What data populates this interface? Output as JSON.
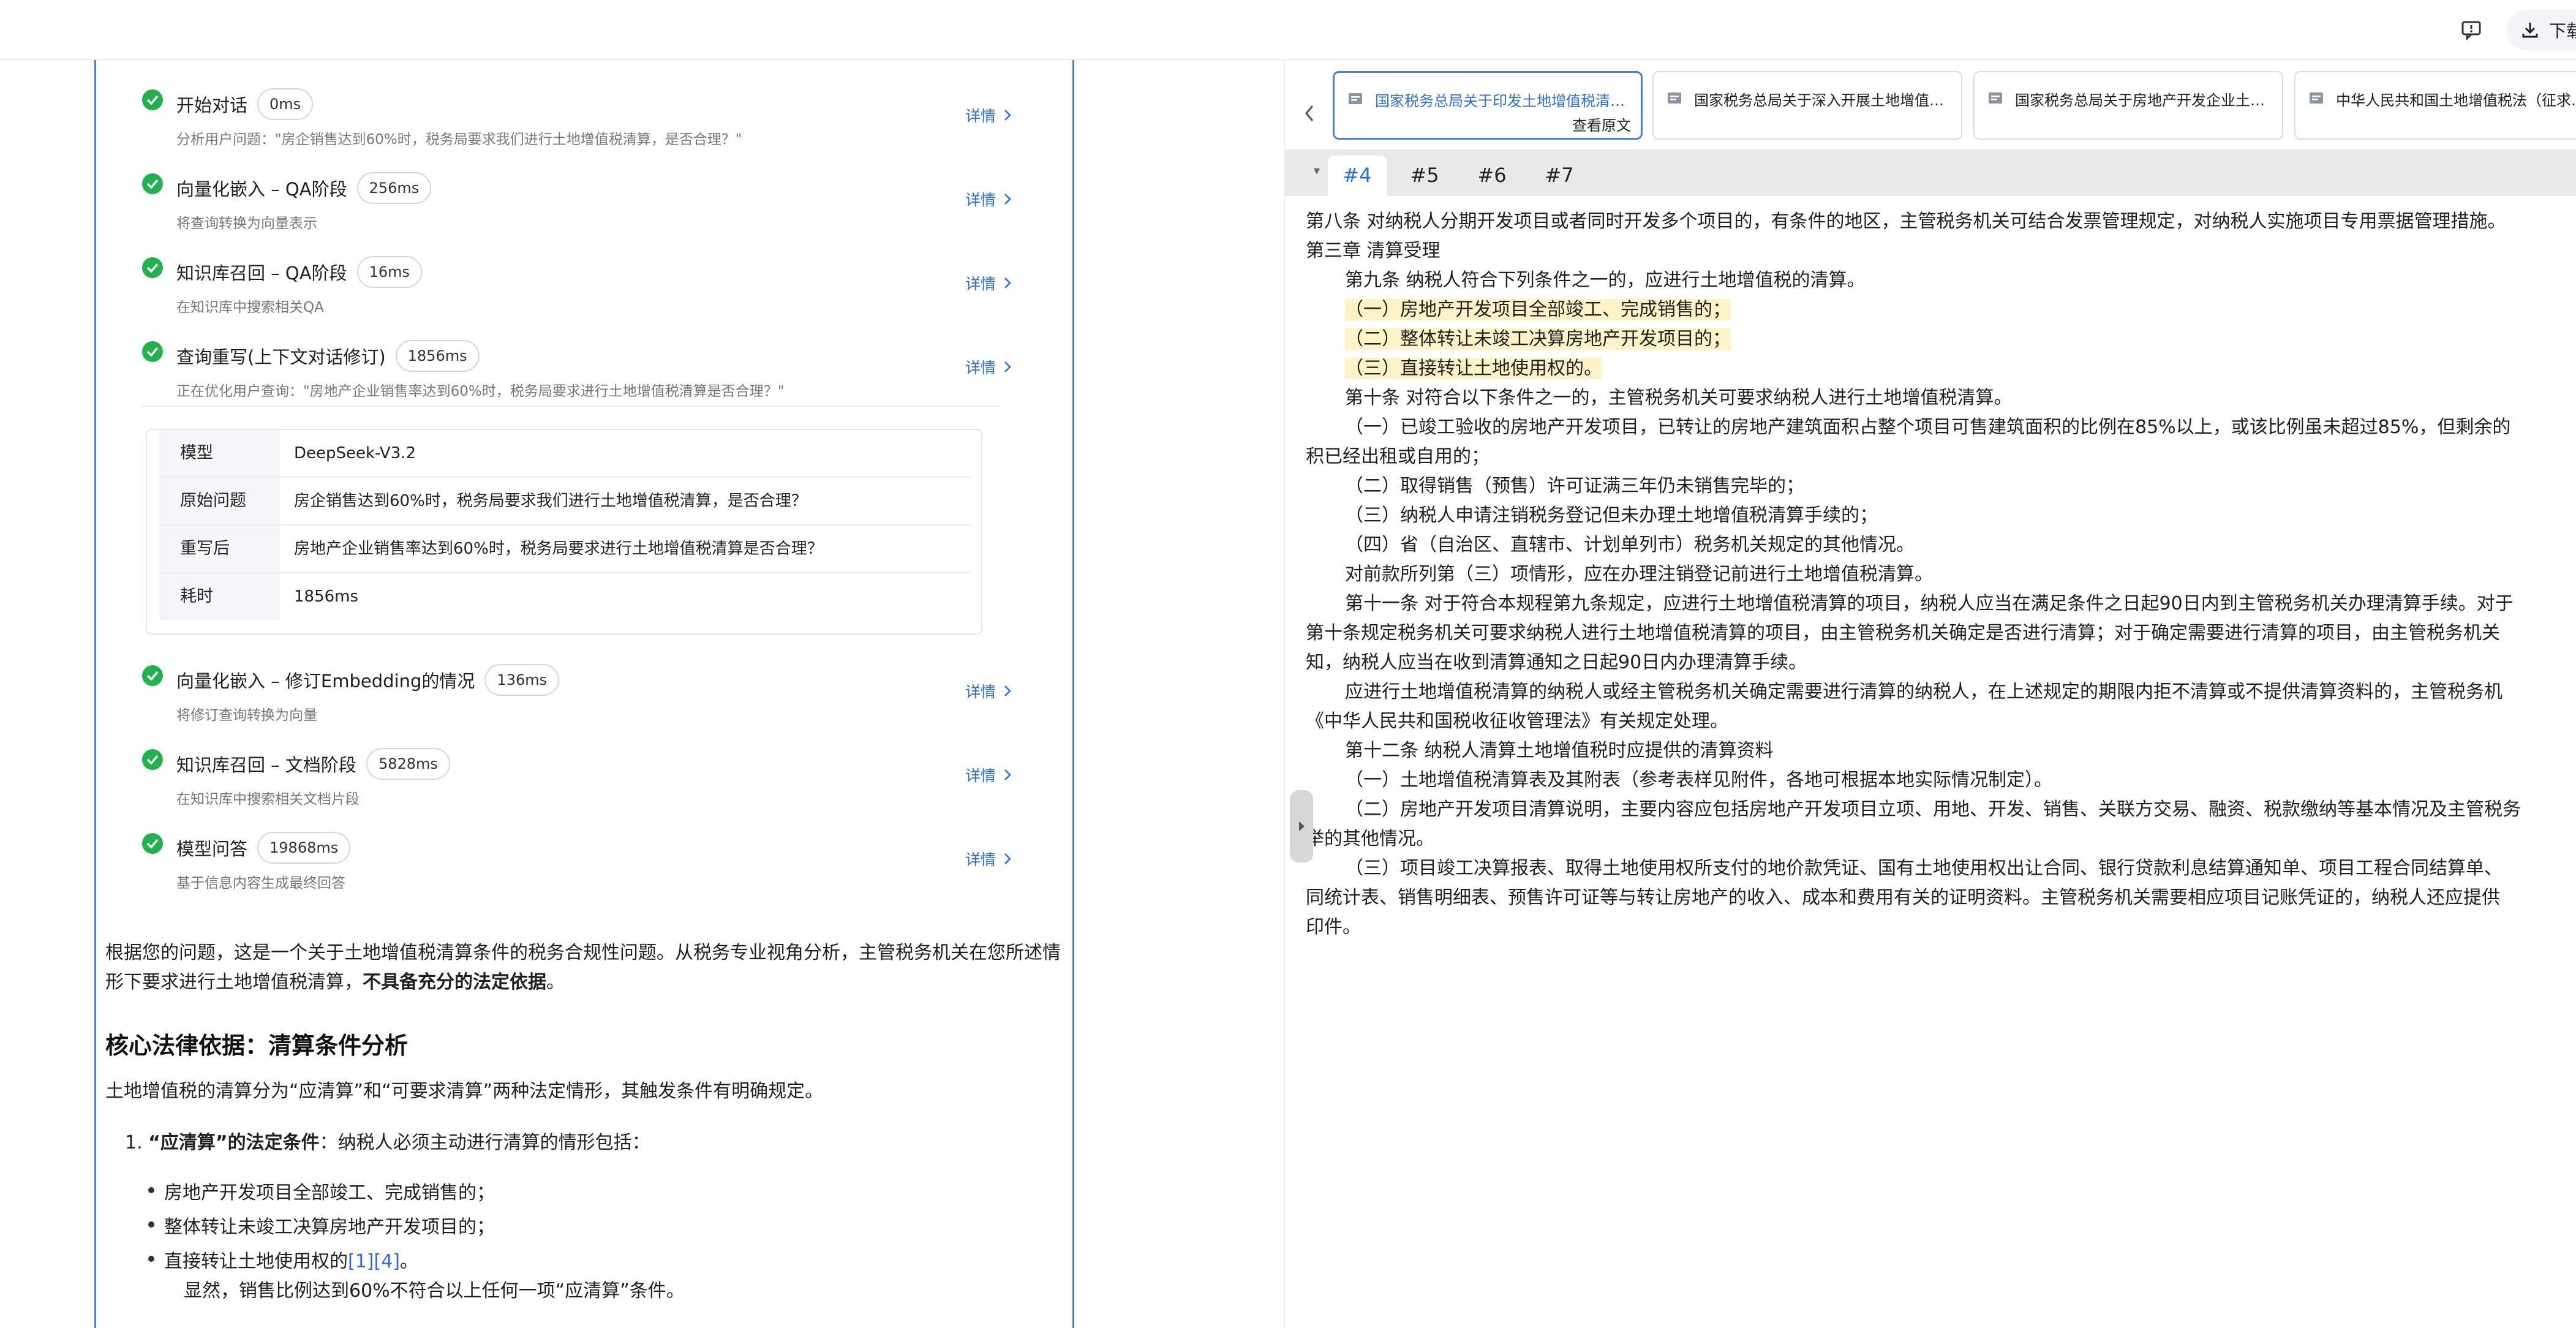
{
  "topbar": {
    "download_label": "下载"
  },
  "steps": [
    {
      "title": "开始对话",
      "time": "0ms",
      "sub": "分析用户问题：\"房企销售达到60%时，税务局要求我们进行土地增值税清算，是否合理？\"",
      "detail": "详情"
    },
    {
      "title": "向量化嵌入 – QA阶段",
      "time": "256ms",
      "sub": "将查询转换为向量表示",
      "detail": "详情"
    },
    {
      "title": "知识库召回 – QA阶段",
      "time": "16ms",
      "sub": "在知识库中搜索相关QA",
      "detail": "详情"
    },
    {
      "title": "查询重写(上下文对话修订)",
      "time": "1856ms",
      "sub": "正在优化用户查询：\"房地产企业销售率达到60%时，税务局要求进行土地增值税清算是否合理？\"",
      "detail": "详情"
    },
    {
      "title": "向量化嵌入 – 修订Embedding的情况",
      "time": "136ms",
      "sub": "将修订查询转换为向量",
      "detail": "详情"
    },
    {
      "title": "知识库召回 – 文档阶段",
      "time": "5828ms",
      "sub": "在知识库中搜索相关文档片段",
      "detail": "详情"
    },
    {
      "title": "模型问答",
      "time": "19868ms",
      "sub": "基于信息内容生成最终回答",
      "detail": "详情"
    }
  ],
  "info_table": [
    {
      "key": "模型",
      "value": "DeepSeek-V3.2"
    },
    {
      "key": "原始问题",
      "value": "房企销售达到60%时，税务局要求我们进行土地增值税清算，是否合理？"
    },
    {
      "key": "重写后",
      "value": "房地产企业销售率达到60%时，税务局要求进行土地增值税清算是否合理？"
    },
    {
      "key": "耗时",
      "value": "1856ms"
    }
  ],
  "answer": {
    "intro_a": "根据您的问题，这是一个关于土地增值税清算条件的税务合规性问题。从税务专业视角分析，主管税务机关在您所述情形下要求进行土地增值税清算，",
    "intro_b": "不具备充分的法定依据",
    "intro_c": "。",
    "heading": "核心法律依据：清算条件分析",
    "para": "土地增值税的清算分为“应清算”和“可要求清算”两种法定情形，其触发条件有明确规定。",
    "item1_num": "1.",
    "item1_bold": "“应清算”的法定条件",
    "item1_rest": "：纳税人必须主动进行清算的情形包括：",
    "bullets": [
      "房地产开发项目全部竣工、完成销售的；",
      "整体转让未竣工决算房地产开发项目的；",
      "直接转让土地使用权的"
    ],
    "cite": "[1][4]",
    "bullet3_end": "。",
    "note": "显然，销售比例达到60%不符合以上任何一项“应清算”条件。"
  },
  "doc_tabs": [
    {
      "title": "国家税务总局关于印发土地增值税清算管理规程的通知",
      "view": "查看原文"
    },
    {
      "title": "国家税务总局关于深入开展土地增值税清算的通知"
    },
    {
      "title": "国家税务总局关于房地产开发企业土地增值税清算"
    },
    {
      "title": "中华人民共和国土地增值税法（征求意见稿）"
    }
  ],
  "page_tabs": [
    "#4",
    "#5",
    "#6",
    "#7"
  ],
  "doc_lines": [
    {
      "text": "第八条 对纳税人分期开发项目或者同时开发多个项目的，有条件的地区，主管税务机关可结合发票管理规定，对纳税人实施项目专用票据管理措施。",
      "indent": false,
      "hl": false
    },
    {
      "text": "第三章 清算受理",
      "indent": false,
      "hl": false
    },
    {
      "text": "第九条 纳税人符合下列条件之一的，应进行土地增值税的清算。",
      "indent": true,
      "hl": false
    },
    {
      "text": "（一）房地产开发项目全部竣工、完成销售的；",
      "indent": true,
      "hl": true
    },
    {
      "text": "（二）整体转让未竣工决算房地产开发项目的；",
      "indent": true,
      "hl": true
    },
    {
      "text": "（三）直接转让土地使用权的。",
      "indent": true,
      "hl": true
    },
    {
      "text": "第十条 对符合以下条件之一的，主管税务机关可要求纳税人进行土地增值税清算。",
      "indent": true,
      "hl": false
    },
    {
      "text": "（一）已竣工验收的房地产开发项目，已转让的房地产建筑面积占整个项目可售建筑面积的比例在85%以上，或该比例虽未超过85%，但剩余的",
      "indent": true,
      "hl": false
    },
    {
      "text": "积已经出租或自用的；",
      "indent": false,
      "hl": false
    },
    {
      "text": "（二）取得销售（预售）许可证满三年仍未销售完毕的；",
      "indent": true,
      "hl": false
    },
    {
      "text": "（三）纳税人申请注销税务登记但未办理土地增值税清算手续的；",
      "indent": true,
      "hl": false
    },
    {
      "text": "（四）省（自治区、直辖市、计划单列市）税务机关规定的其他情况。",
      "indent": true,
      "hl": false
    },
    {
      "text": "对前款所列第（三）项情形，应在办理注销登记前进行土地增值税清算。",
      "indent": true,
      "hl": false
    },
    {
      "text": "第十一条 对于符合本规程第九条规定，应进行土地增值税清算的项目，纳税人应当在满足条件之日起90日内到主管税务机关办理清算手续。对于",
      "indent": true,
      "hl": false
    },
    {
      "text": "第十条规定税务机关可要求纳税人进行土地增值税清算的项目，由主管税务机关确定是否进行清算；对于确定需要进行清算的项目，由主管税务机关",
      "indent": false,
      "hl": false
    },
    {
      "text": "知，纳税人应当在收到清算通知之日起90日内办理清算手续。",
      "indent": false,
      "hl": false
    },
    {
      "text": "应进行土地增值税清算的纳税人或经主管税务机关确定需要进行清算的纳税人，在上述规定的期限内拒不清算或不提供清算资料的，主管税务机",
      "indent": true,
      "hl": false
    },
    {
      "text": "《中华人民共和国税收征收管理法》有关规定处理。",
      "indent": false,
      "hl": false
    },
    {
      "text": "第十二条 纳税人清算土地增值税时应提供的清算资料",
      "indent": true,
      "hl": false
    },
    {
      "text": "（一）土地增值税清算表及其附表（参考表样见附件，各地可根据本地实际情况制定）。",
      "indent": true,
      "hl": false
    },
    {
      "text": "（二）房地产开发项目清算说明，主要内容应包括房地产开发项目立项、用地、开发、销售、关联方交易、融资、税款缴纳等基本情况及主管税务",
      "indent": true,
      "hl": false
    },
    {
      "text": "举的其他情况。",
      "indent": false,
      "hl": false
    },
    {
      "text": "（三）项目竣工决算报表、取得土地使用权所支付的地价款凭证、国有土地使用权出让合同、银行贷款利息结算通知单、项目工程合同结算单、",
      "indent": true,
      "hl": false
    },
    {
      "text": "同统计表、销售明细表、预售许可证等与转让房地产的收入、成本和费用有关的证明资料。主管税务机关需要相应项目记账凭证的，纳税人还应提供",
      "indent": false,
      "hl": false
    },
    {
      "text": "印件。",
      "indent": false,
      "hl": false
    }
  ],
  "colors": {
    "accent": "#2b6de0",
    "success": "#22b14c",
    "highlight": "#fdf3c6",
    "frame": "#4a7fd6"
  }
}
